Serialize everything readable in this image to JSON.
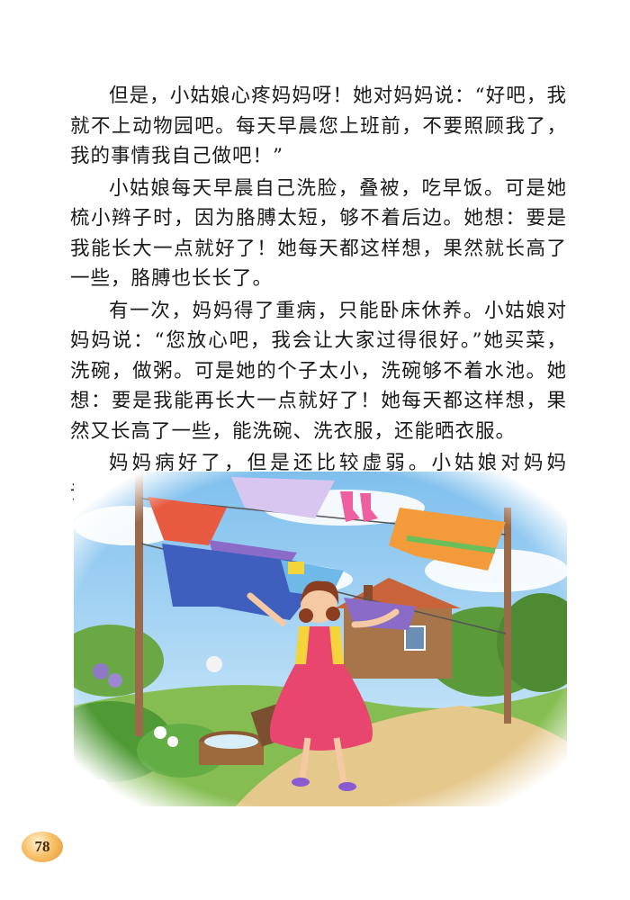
{
  "paragraphs": [
    "但是，小姑娘心疼妈妈呀！她对妈妈说：“好吧，我就不上动物园吧。每天早晨您上班前，不要照顾我了，我的事情我自己做吧！”",
    "小姑娘每天早晨自己洗脸，叠被，吃早饭。可是她梳小辫子时，因为胳膊太短，够不着后边。她想：要是我能长大一点就好了！她每天都这样想，果然就长高了一些，胳膊也长长了。",
    "有一次，妈妈得了重病，只能卧床休养。小姑娘对妈妈说：“您放心吧，我会让大家过得很好。”她买菜，洗碗，做粥。可是她的个子太小，洗碗够不着水池。她想：要是我能再长大一点就好了！她每天都这样想，果然又长高了一些，能洗碗、洗衣服，还能晒衣服。",
    "妈妈病好了，但是还比较虚弱。小姑娘对妈妈说：“您"
  ],
  "page_number": "78",
  "colors": {
    "sky": "#8ec9ef",
    "grass": "#7fb64a",
    "dress": "#e8456f",
    "shirt": "#f4d43a",
    "pole": "#9a6a4a",
    "page_badge": "#f2a94a"
  }
}
